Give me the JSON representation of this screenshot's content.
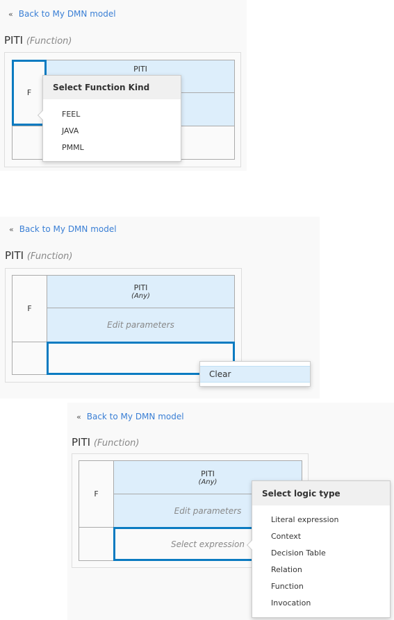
{
  "back_link": "Back to My DMN model",
  "title": "PITI",
  "title_kind": "(Function)",
  "cells": {
    "f": "F",
    "name": "PITI",
    "type": "(Any)",
    "params": "Edit parameters",
    "select_expression": "Select expression"
  },
  "function_kind_popup": {
    "header": "Select Function Kind",
    "items": [
      "FEEL",
      "JAVA",
      "PMML"
    ]
  },
  "context_menu": {
    "items": [
      "Clear"
    ]
  },
  "logic_type_popup": {
    "header": "Select logic type",
    "items": [
      "Literal expression",
      "Context",
      "Decision Table",
      "Relation",
      "Function",
      "Invocation"
    ]
  },
  "colors": {
    "accent": "#0b7bc1",
    "header_fill": "#ddeefb",
    "link": "#3a7fd5"
  }
}
